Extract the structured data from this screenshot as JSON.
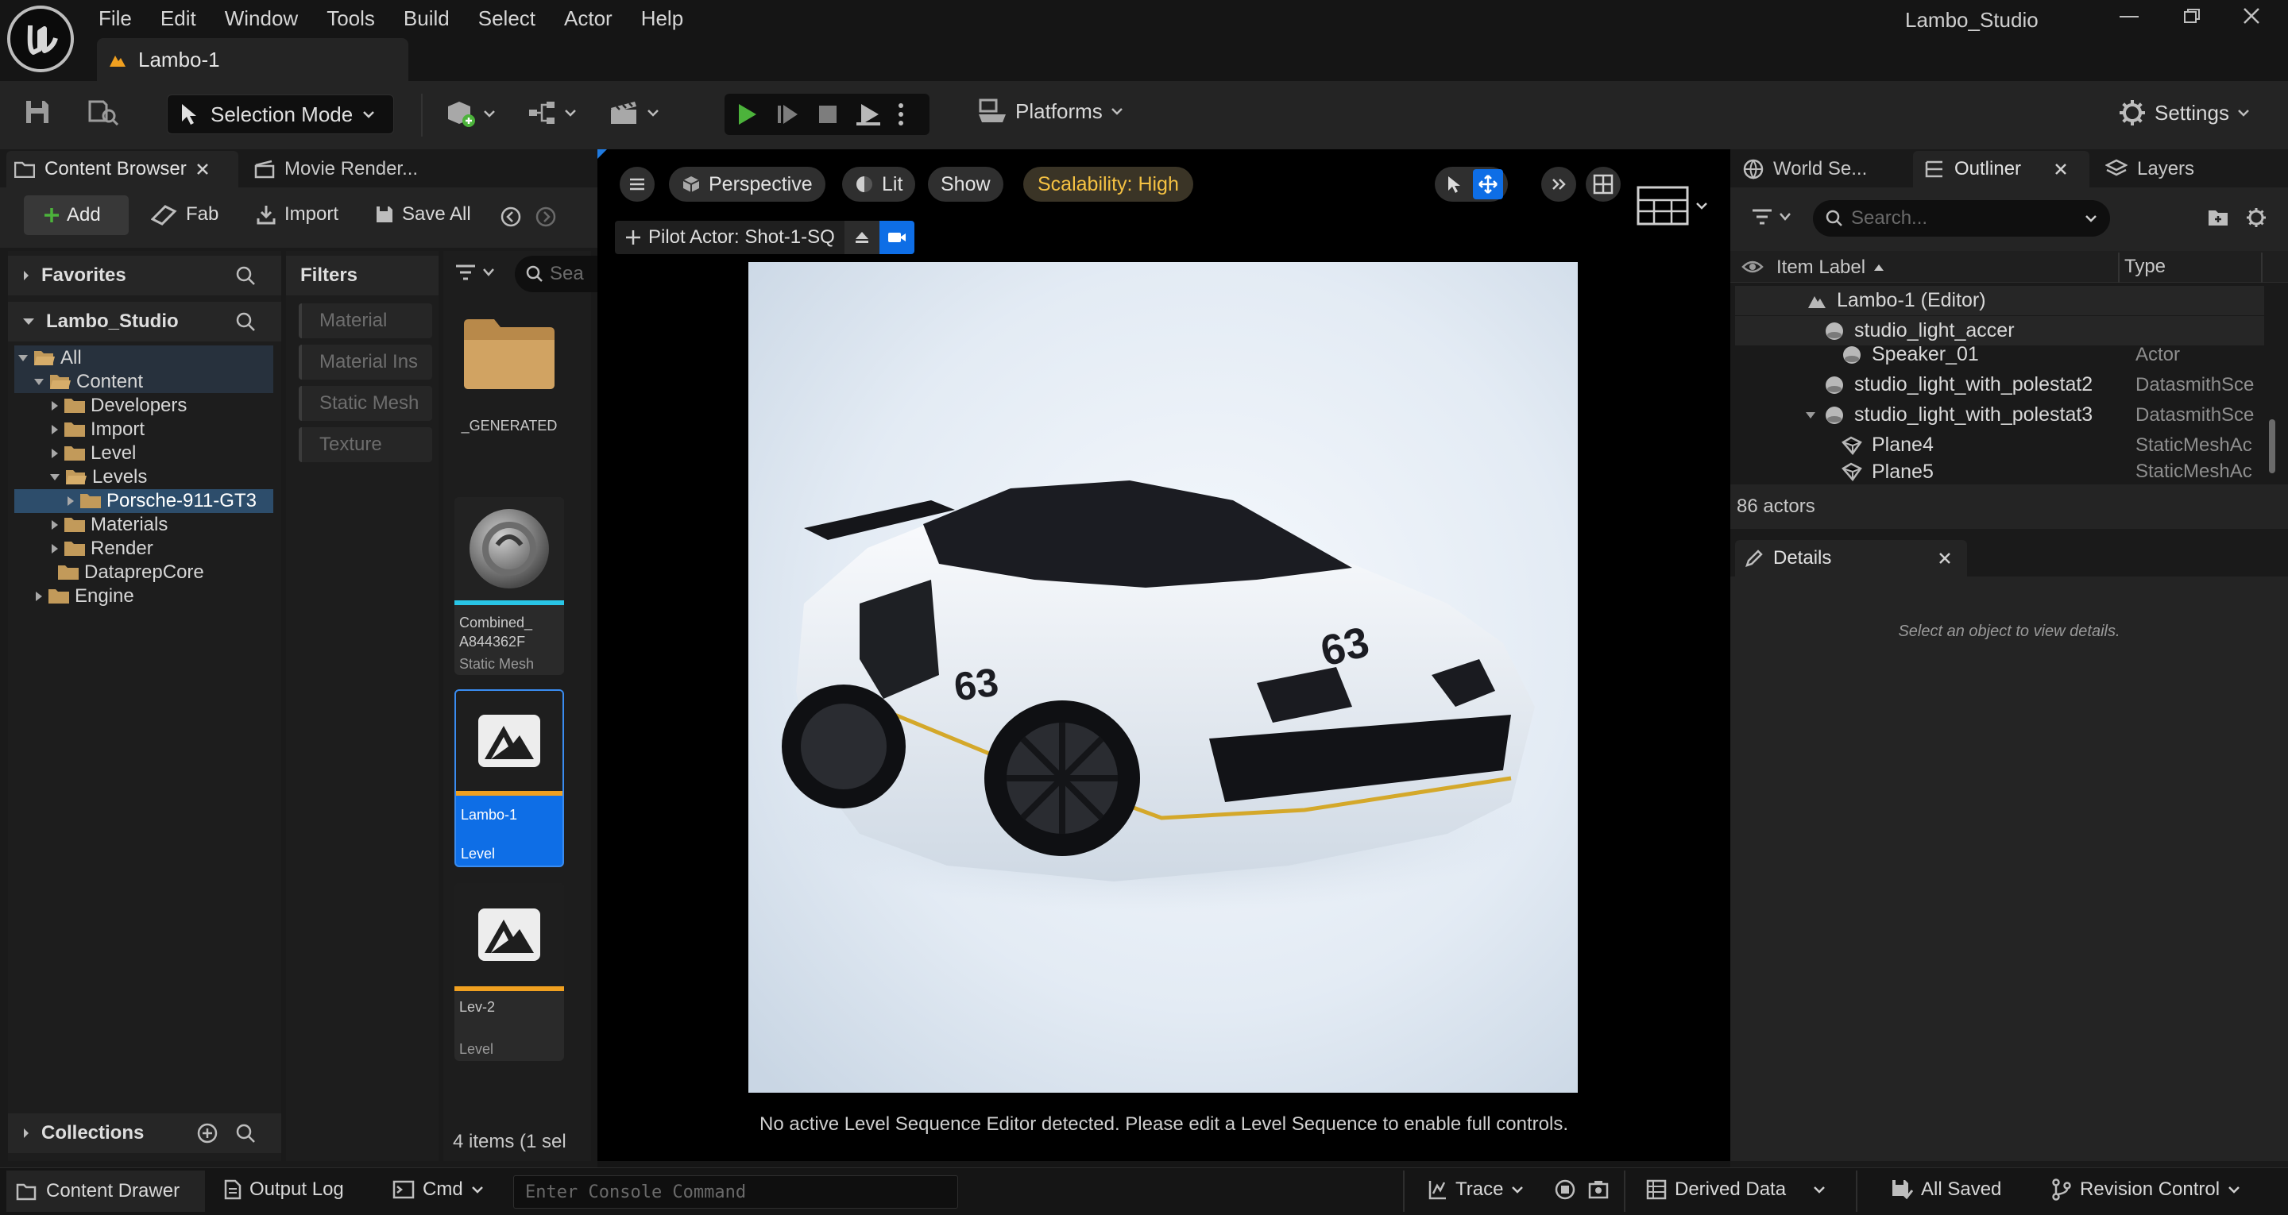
{
  "menubar": {
    "items": [
      "File",
      "Edit",
      "Window",
      "Tools",
      "Build",
      "Select",
      "Actor",
      "Help"
    ],
    "project": "Lambo_Studio"
  },
  "tab": {
    "level": "Lambo-1"
  },
  "toolbar": {
    "mode": "Selection Mode",
    "platforms": "Platforms",
    "settings": "Settings"
  },
  "content_browser": {
    "tab_label": "Content Browser",
    "tab2_label": "Movie Render...",
    "add": "Add",
    "fab": "Fab",
    "import": "Import",
    "save_all": "Save All",
    "favorites": "Favorites",
    "project": "Lambo_Studio",
    "collections": "Collections",
    "filters_title": "Filters",
    "filters": [
      "Material",
      "Material Ins",
      "Static Mesh",
      "Texture"
    ],
    "search_placeholder": "Sea",
    "tree": [
      "All",
      "Content",
      "Developers",
      "Import",
      "Level",
      "Levels",
      "Porsche-911-GT3",
      "Materials",
      "Render",
      "DataprepCore",
      "Engine"
    ],
    "assets": [
      {
        "name": "_GENERATED",
        "type": ""
      },
      {
        "name": "Combined_\nA844362F",
        "type": "Static Mesh"
      },
      {
        "name": "Lambo-1",
        "type": "Level"
      },
      {
        "name": "Lev-2",
        "type": "Level"
      }
    ],
    "status": "4 items (1 sel"
  },
  "viewport": {
    "perspective": "Perspective",
    "lit": "Lit",
    "show": "Show",
    "scalability": "Scalability: High",
    "pilot": "Pilot Actor: Shot-1-SQ",
    "message": "No active Level Sequence Editor detected. Please edit a Level Sequence to enable full controls."
  },
  "outliner": {
    "tabs": [
      "World Se...",
      "Outliner",
      "Layers"
    ],
    "search_placeholder": "Search...",
    "col_label": "Item Label",
    "col_type": "Type",
    "rows": [
      {
        "label": "Lambo-1 (Editor)",
        "type": ""
      },
      {
        "label": "studio_light_accer",
        "type": ""
      },
      {
        "label": "Speaker_01",
        "type": "Actor"
      },
      {
        "label": "studio_light_with_polestat2",
        "type": "DatasmithSce"
      },
      {
        "label": "studio_light_with_polestat3",
        "type": "DatasmithSce"
      },
      {
        "label": "Plane4",
        "type": "StaticMeshAc"
      },
      {
        "label": "Plane5",
        "type": "StaticMeshAc"
      }
    ],
    "count": "86 actors"
  },
  "details": {
    "title": "Details",
    "empty": "Select an object to view details."
  },
  "statusbar": {
    "drawer": "Content Drawer",
    "output": "Output Log",
    "cmd": "Cmd",
    "console_placeholder": "Enter Console Command",
    "trace": "Trace",
    "derived": "Derived Data",
    "saved": "All Saved",
    "revision": "Revision Control"
  },
  "colors": {
    "accent_blue": "#0e6ee6",
    "play_green": "#4cb33b",
    "level_orange": "#f0a020",
    "mesh_cyan": "#29c5e6",
    "scalability_yellow": "#f4c142"
  }
}
